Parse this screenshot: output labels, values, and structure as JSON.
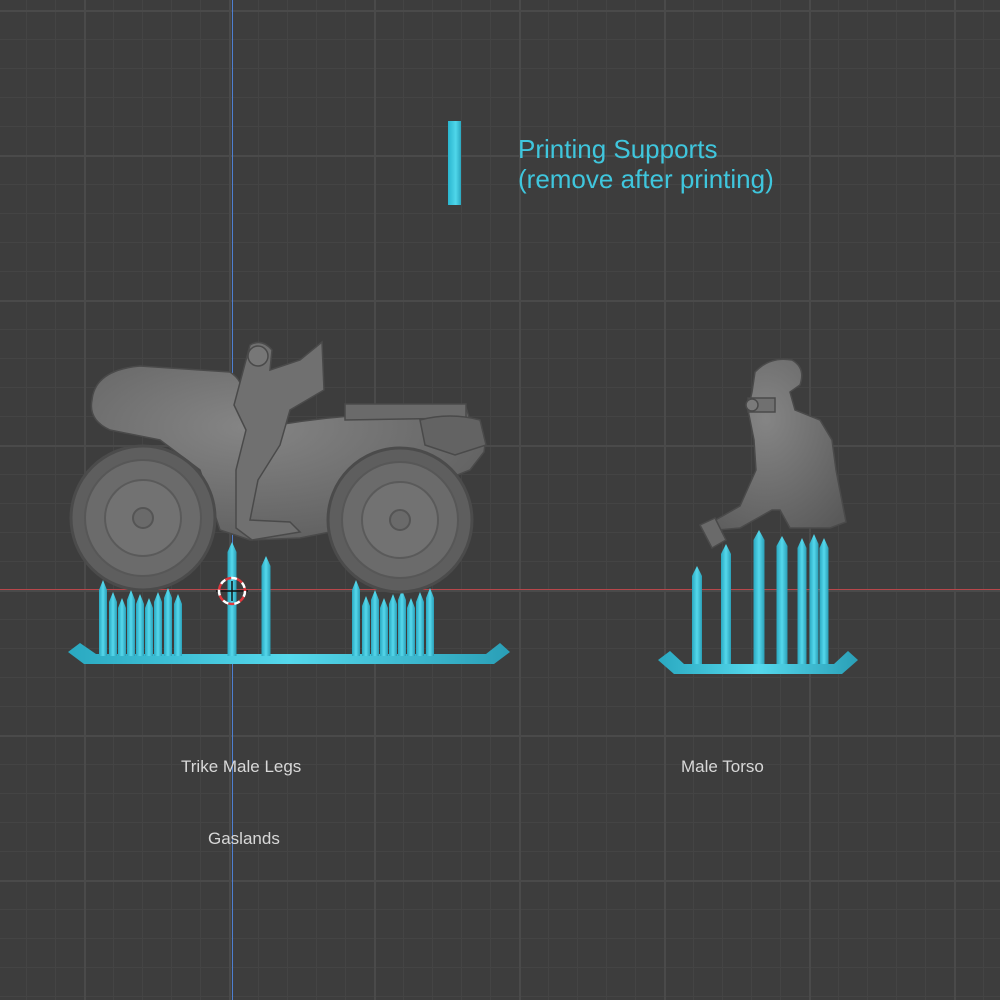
{
  "viewport": {
    "background_color": "#3d3d3d",
    "grid_color": "#4a4a4a",
    "x_axis_color": "#b8464a",
    "z_axis_color": "#4e7fd0"
  },
  "legend": {
    "title": "Printing Supports",
    "subtitle": "(remove after printing)",
    "color": "#3fc6dd"
  },
  "models": {
    "trike": {
      "label": "Trike Male Legs"
    },
    "torso": {
      "label": "Male Torso"
    }
  },
  "collection": {
    "label": "Gaslands"
  },
  "colors": {
    "support": "#3fc6dd",
    "mesh": "#6e6e6e",
    "mesh_dark": "#555555"
  },
  "icons": {
    "cursor": "3d-cursor-icon"
  }
}
